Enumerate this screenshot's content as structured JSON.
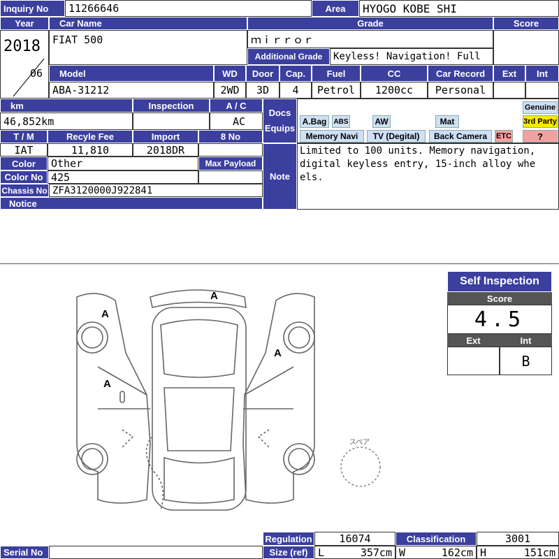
{
  "labels": {
    "inquiry_no": "Inquiry No",
    "area": "Area",
    "year": "Year",
    "car_name": "Car Name",
    "grade": "Grade",
    "score": "Score",
    "additional_grade": "Additional Grade",
    "model": "Model",
    "wd": "WD",
    "door": "Door",
    "cap": "Cap.",
    "fuel": "Fuel",
    "cc": "CC",
    "car_record": "Car Record",
    "ext": "Ext",
    "int": "Int",
    "km": "km",
    "inspection": "Inspection",
    "ac": "A / C",
    "docs_equips": "Docs Equips",
    "genuine": "Genuine",
    "third_party": "3rd Party",
    "tm": "T / M",
    "recyle_fee": "Recyle Fee",
    "import": "Import",
    "eight_no": "8 No",
    "color": "Color",
    "max_payload": "Max Payload",
    "note": "Note",
    "color_no": "Color No",
    "chassis_no": "Chassis No",
    "notice": "Notice",
    "regulation": "Regulation",
    "classification": "Classification",
    "size_ref": "Size (ref)",
    "serial_no": "Serial No",
    "L": "L",
    "W": "W",
    "H": "H",
    "question": "?"
  },
  "values": {
    "inquiry_no": "11266646",
    "area": "HYOGO KOBE SHI",
    "year": "2018",
    "month": "06",
    "car_name": "FIAT 500",
    "grade": "ｍｉｒｒｏｒ",
    "additional_grade": "Keyless! Navigation! Full",
    "model": "ABA-31212",
    "wd": "2WD",
    "door": "3D",
    "cap": "4",
    "fuel": "Petrol",
    "cc": "1200cc",
    "car_record": "Personal",
    "km": "46,852km",
    "ac": "AC",
    "tm": "IAT",
    "recyle_fee": "11,810",
    "import": "2018DR",
    "color": "Other",
    "color_no": "425",
    "chassis_no": "ZFA3120000J922841",
    "note": "Limited to 100 units. Memory navigation, digital keyless entry, 15-inch alloy wheels.",
    "regulation": "16074",
    "classification": "3001",
    "length": "357cm",
    "width": "162cm",
    "height": "151cm"
  },
  "equips": {
    "abag": "A.Bag",
    "abs": "ABS",
    "aw": "AW",
    "mat": "Mat",
    "memory_navi": "Memory Navi",
    "tv": "TV (Degital)",
    "back_camera": "Back Camera",
    "etc": "ETC"
  },
  "self_inspection": {
    "title": "Self Inspection",
    "score_label": "Score",
    "score": "4.5",
    "ext_label": "Ext",
    "int_label": "Int",
    "ext": "",
    "int": "B"
  },
  "diagram": {
    "marks": [
      "A",
      "A",
      "A",
      "A"
    ],
    "spare_label": "スペア"
  },
  "colors": {
    "header": "#3b3f9e",
    "badge_blue": "#cfe0f5",
    "badge_yellow": "#ffe800",
    "badge_pink": "#f4a0a0"
  }
}
